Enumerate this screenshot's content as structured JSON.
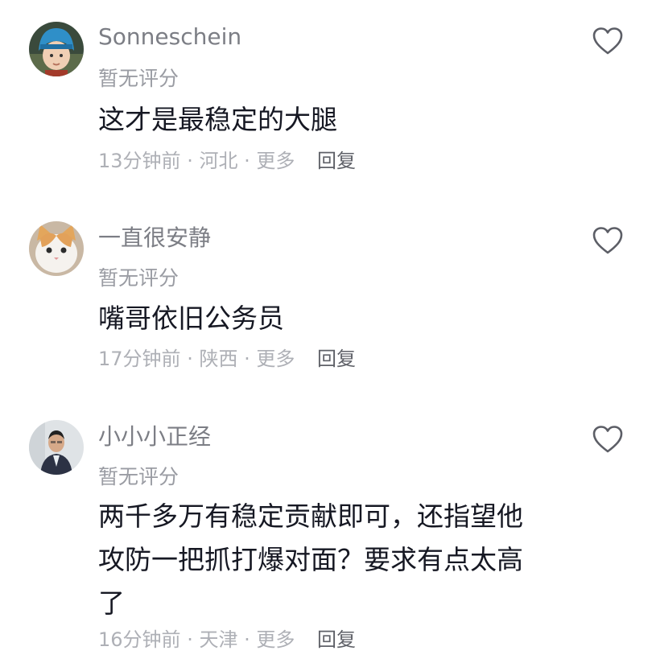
{
  "comments": [
    {
      "username": "Sonneschein",
      "rating": "暂无评分",
      "text": "这才是最稳定的大腿",
      "time": "13分钟前",
      "location": "河北",
      "more": "更多",
      "reply": "回复",
      "avatar_icon": "child-in-blue-hat-avatar",
      "like_icon": "heart-outline-icon"
    },
    {
      "username": "一直很安静",
      "rating": "暂无评分",
      "text": "嘴哥依旧公务员",
      "time": "17分钟前",
      "location": "陕西",
      "more": "更多",
      "reply": "回复",
      "avatar_icon": "white-cat-avatar",
      "like_icon": "heart-outline-icon"
    },
    {
      "username": "小小小正经",
      "rating": "暂无评分",
      "text": "两千多万有稳定贡献即可，还指望他\n攻防一把抓打爆对面？要求有点太高\n了",
      "time": "16分钟前",
      "location": "天津",
      "more": "更多",
      "reply": "回复",
      "avatar_icon": "man-in-suit-avatar",
      "like_icon": "heart-outline-icon"
    }
  ],
  "colors": {
    "username": "#7c7e85",
    "text": "#161823",
    "meta": "#aeb0b6",
    "reply": "#5f6168"
  }
}
